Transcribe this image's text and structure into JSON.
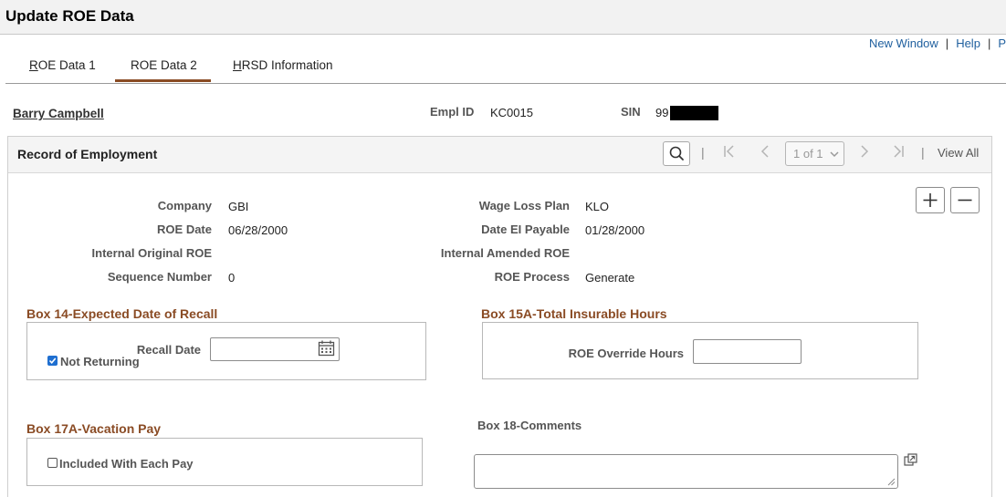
{
  "page": {
    "title": "Update ROE Data"
  },
  "top_links": {
    "new_window": "New Window",
    "help": "Help",
    "third": "P",
    "sep": "|"
  },
  "tabs": [
    {
      "label": "ROE Data 1",
      "accesskey_letter": "R",
      "rest": "OE Data 1",
      "active": false
    },
    {
      "label": "ROE Data 2",
      "active": true
    },
    {
      "label": "HRSD Information",
      "accesskey_letter": "H",
      "rest": "RSD Information",
      "active": false
    }
  ],
  "employee": {
    "name": "Barry Campbell",
    "empl_id_label": "Empl ID",
    "empl_id_value": "KC0015",
    "sin_label": "SIN",
    "sin_value_visible": "99"
  },
  "grid": {
    "title": "Record of Employment",
    "pager": "1 of 1",
    "view_all": "View All",
    "sep": "|"
  },
  "fields": {
    "company_label": "Company",
    "company_value": "GBI",
    "roe_date_label": "ROE Date",
    "roe_date_value": "06/28/2000",
    "internal_original_label": "Internal Original ROE",
    "sequence_label": "Sequence Number",
    "sequence_value": "0",
    "wage_loss_label": "Wage Loss Plan",
    "wage_loss_value": "KLO",
    "date_ei_label": "Date EI Payable",
    "date_ei_value": "01/28/2000",
    "internal_amended_label": "Internal Amended ROE",
    "roe_process_label": "ROE Process",
    "roe_process_value": "Generate"
  },
  "box14": {
    "title": "Box 14-Expected Date of Recall",
    "recall_date_label": "Recall Date",
    "recall_date_value": "",
    "not_returning_label": "Not Returning",
    "not_returning_checked": true
  },
  "box15a": {
    "title": "Box 15A-Total Insurable Hours",
    "override_label": "ROE Override Hours",
    "override_value": ""
  },
  "box17a": {
    "title": "Box 17A-Vacation Pay",
    "included_label": "Included With Each Pay",
    "included_checked": false
  },
  "box18": {
    "title": "Box 18-Comments",
    "comments_value": ""
  },
  "colors": {
    "accent_brown": "#8a4b24",
    "link_blue": "#1f5f9e",
    "checkbox_blue": "#1f6fd0"
  }
}
